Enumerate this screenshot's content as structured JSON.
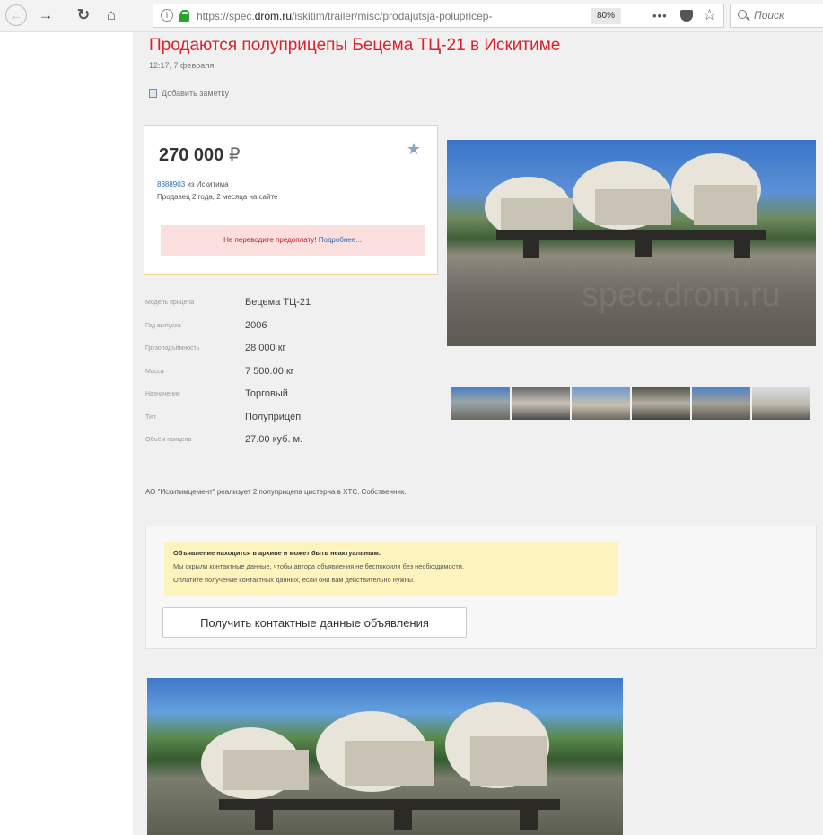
{
  "browser": {
    "url_prefix": "https://spec.",
    "url_domain": "drom.ru",
    "url_path": "/iskitim/trailer/misc/prodajutsja-polupricep-",
    "zoom": "80%",
    "more": "•••",
    "search_placeholder": "Поиск"
  },
  "listing": {
    "title": "Продаются полуприцепы Бецема ТЦ-21 в Искитиме",
    "date": "12:17, 7 февраля",
    "add_note": "Добавить заметку",
    "price": "270 000",
    "currency": "₽",
    "seller_id": "8388903",
    "seller_city": " из Искитима",
    "seller_age": "Продавец 2 года, 2 месяца на сайте",
    "warning": "Не переводите предоплату!",
    "warning_more": "Подробнее...",
    "specs": [
      {
        "key": "Модель прицепа",
        "value": "Бецема ТЦ-21"
      },
      {
        "key": "Год выпуска",
        "value": "2006"
      },
      {
        "key": "Грузоподъёмность",
        "value": "28 000 кг"
      },
      {
        "key": "Масса",
        "value": "7 500.00 кг"
      },
      {
        "key": "Назначение",
        "value": "Торговый"
      },
      {
        "key": "Тип",
        "value": "Полуприцеп"
      },
      {
        "key": "Объём прицепа",
        "value": "27.00 куб. м."
      }
    ],
    "description": "АО \"Искитимцемент\" реализует 2 полуприцепа цистерна в ХТС. Собственник.",
    "archive": {
      "line1": "Объявление находится в архиве и может быть неактуальным.",
      "line2": "Мы скрыли контактные данные, чтобы автора объявления не беспокоили без необходимости.",
      "line3": "Оплатите получение контактных данных, если они вам действительно нужны.",
      "button": "Получить контактные данные объявления"
    },
    "watermark": "spec.drom.ru"
  },
  "colors": {
    "title": "#d9232d",
    "link": "#2b6fbd",
    "warning_bg": "#fbdede",
    "archive_bg": "#fdf3bc",
    "price_border": "#f0d08a"
  }
}
